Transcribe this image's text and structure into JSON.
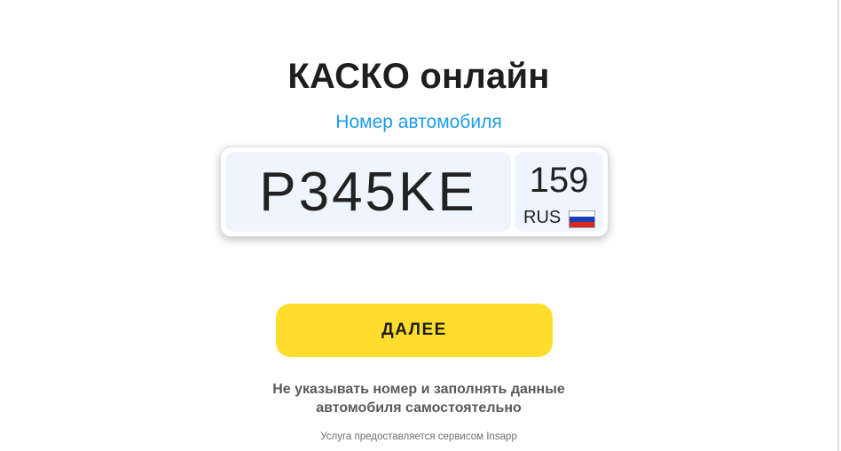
{
  "header": {
    "title": "КАСКО онлайн",
    "subtitle": "Номер автомобиля"
  },
  "plate": {
    "number": "P345KE",
    "region": "159",
    "country": "RUS",
    "flag_colors": [
      "#ffffff",
      "#1c3fb8",
      "#d52b1e"
    ]
  },
  "actions": {
    "next_label": "ДАЛЕЕ",
    "manual_line1": "Не указывать номер и заполнять данные",
    "manual_line2": "автомобиля самостоятельно"
  },
  "footer": {
    "text": "Услуга предоставляется сервисом Insapp"
  },
  "colors": {
    "accent_link": "#1e9be9",
    "button_bg": "#ffdd2d",
    "plate_bg": "#eff5fe"
  }
}
